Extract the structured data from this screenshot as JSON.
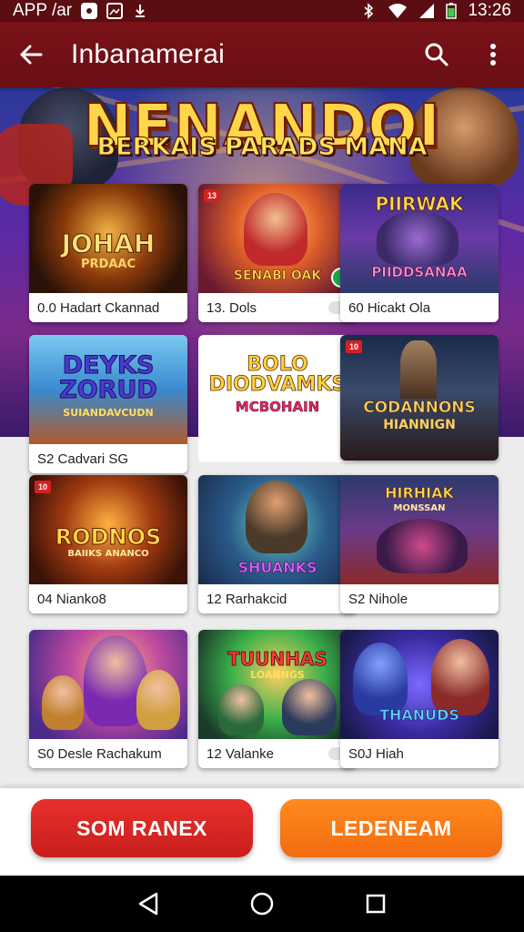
{
  "status_bar": {
    "app_label": "APP /ar",
    "time": "13:26"
  },
  "app_bar": {
    "title": "Inbanamerai"
  },
  "hero": {
    "title": "NENANDOI",
    "subtitle": "BERKAIS PARADS MANA"
  },
  "cards": [
    {
      "art_text": "JOHAH",
      "art_sub": "PRDAAC",
      "caption": "0.0 Hadart Ckannad"
    },
    {
      "art_text": "SENABI OAK",
      "caption": "13. Dols",
      "badge": "13"
    },
    {
      "art_text": "PIIRWAK",
      "art_sub": "PIIDDSANAA",
      "caption": "60 Hicakt Ola"
    },
    {
      "art_text": "DEYKS ZORUD",
      "art_sub": "SUIANDAVCUDN",
      "caption": "S2 Cadvari SG"
    },
    {
      "art_text": "BOLO DIODVAMKS",
      "art_sub": "MCBOHAIN"
    },
    {
      "art_text": "CODANNONS",
      "art_sub": "HIANNIGN",
      "badge": "10"
    },
    {
      "art_text": "RODNOS",
      "art_sub": "BAIIKS ANANCO",
      "caption": "04 Nianko8",
      "badge": "10"
    },
    {
      "art_text": "SHUANKS",
      "caption": "12 Rarhakcid"
    },
    {
      "art_text": "HIRHIAK",
      "art_sub": "MONSSAN",
      "caption": "S2 Nihole"
    },
    {
      "caption": "S0 Desle Rachakum"
    },
    {
      "art_text": "TUUNHAS",
      "art_sub": "LOANNGS",
      "caption": "12 Valanke"
    },
    {
      "art_text": "THANUDS",
      "caption": "S0J Hiah"
    }
  ],
  "buttons": {
    "primary": "SOM RANEX",
    "secondary": "LEDENEAM"
  },
  "colors": {
    "app_bar": "#7a1218",
    "primary_button": "#e02a26",
    "secondary_button": "#f57a18"
  },
  "icons": [
    "back-arrow-icon",
    "search-icon",
    "more-vert-icon",
    "nav-back-icon",
    "nav-home-icon",
    "nav-recents-icon"
  ]
}
